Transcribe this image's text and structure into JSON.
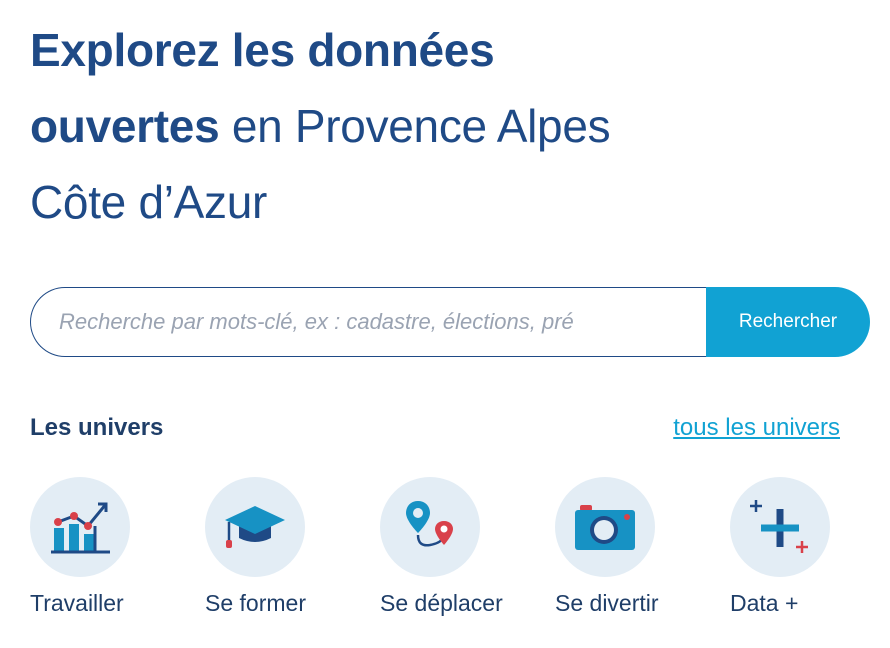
{
  "hero": {
    "title_bold_1": "Explorez les données",
    "title_bold_2": "ouvertes",
    "title_rest_2": " en Provence Alpes",
    "title_line_3": "Côte d’Azur"
  },
  "search": {
    "placeholder": "Recherche par mots-clé, ex : cadastre, élections, pré",
    "button_label": "Rechercher"
  },
  "universes": {
    "title": "Les univers",
    "all_link": "tous les univers",
    "items": [
      {
        "label": "Travailler",
        "icon": "chart-growth-icon"
      },
      {
        "label": "Se former",
        "icon": "graduation-cap-icon"
      },
      {
        "label": "Se déplacer",
        "icon": "route-pins-icon"
      },
      {
        "label": "Se divertir",
        "icon": "camera-icon"
      },
      {
        "label": "Data +",
        "icon": "plus-icon"
      }
    ]
  },
  "colors": {
    "navy": "#1f4a86",
    "accent": "#11a2d3",
    "circle_bg": "#e3edf5",
    "red": "#d9414a"
  }
}
